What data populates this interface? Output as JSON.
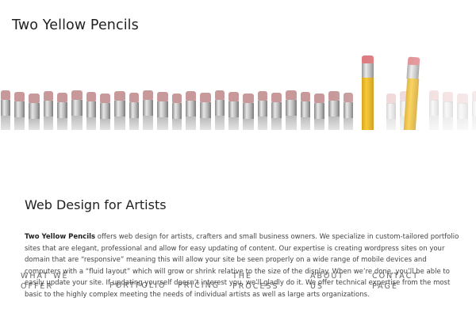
{
  "site": {
    "title": "Two Yellow Pencils"
  },
  "nav": {
    "items": [
      {
        "label_line1": "WHAT WE",
        "label_line2": "OFFER"
      },
      {
        "label_line1": "PORTFOLIO",
        "label_line2": ""
      },
      {
        "label_line1": "PRICING",
        "label_line2": ""
      },
      {
        "label_line1": "THE",
        "label_line2": "PROCESS"
      },
      {
        "label_line1": "ABOUT",
        "label_line2": "US"
      },
      {
        "label_line1": "CONTACT",
        "label_line2": "PAGE"
      }
    ]
  },
  "banner": {
    "alt": "Row of pencils with two yellow pencils standing out"
  },
  "main": {
    "heading": "Web Design for Artists",
    "intro_bold": "Two Yellow Pencils",
    "intro_rest": " offers web design for artists, crafters and small business owners. We specialize in custom-tailored portfolio sites that are elegant, professional and allow for easy updating of content. Our expertise is creating wordpress sites on your domain that are “responsive” meaning this will allow your site be seen properly on a wide range of mobile devices and computers with a “fluid layout” which will grow or shrink relative to the size of the display. When we’re done, you’ll be able to easily update your site. If updating yourself doesn’t interest you, we’ll gladly do it. We offer technical expertise from the most basic to the highly complex meeting the needs of individual artists as well as large arts organizations."
  }
}
